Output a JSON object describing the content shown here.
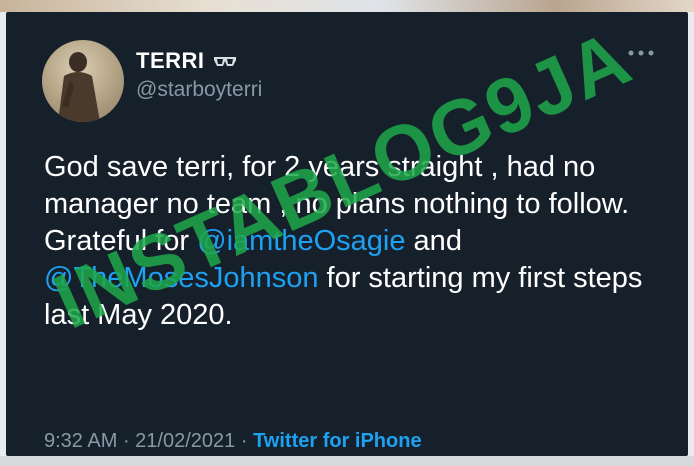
{
  "tweet": {
    "display_name": "TERRI",
    "handle": "@starboyterri",
    "text_segments": [
      {
        "text": "God save terri, for 2 years straight , had no manager no team , no plans nothing to follow. Grateful for ",
        "mention": false
      },
      {
        "text": "@iamtheOsagie",
        "mention": true
      },
      {
        "text": " and ",
        "mention": false
      },
      {
        "text": "@TheMosesJohnson",
        "mention": true
      },
      {
        "text": " for starting my first steps last May 2020.",
        "mention": false
      }
    ],
    "time": "9:32 AM",
    "separator": " · ",
    "date": "21/02/2021",
    "source": "Twitter for iPhone"
  },
  "watermark": {
    "text": "INSTABLOG9JA",
    "color": "#1fa84a"
  },
  "colors": {
    "background": "#15202b",
    "text": "#ffffff",
    "secondary": "#8899a6",
    "accent": "#1da1f2"
  },
  "icons": {
    "badge": "sunglasses-icon",
    "menu": "more-options-icon"
  }
}
